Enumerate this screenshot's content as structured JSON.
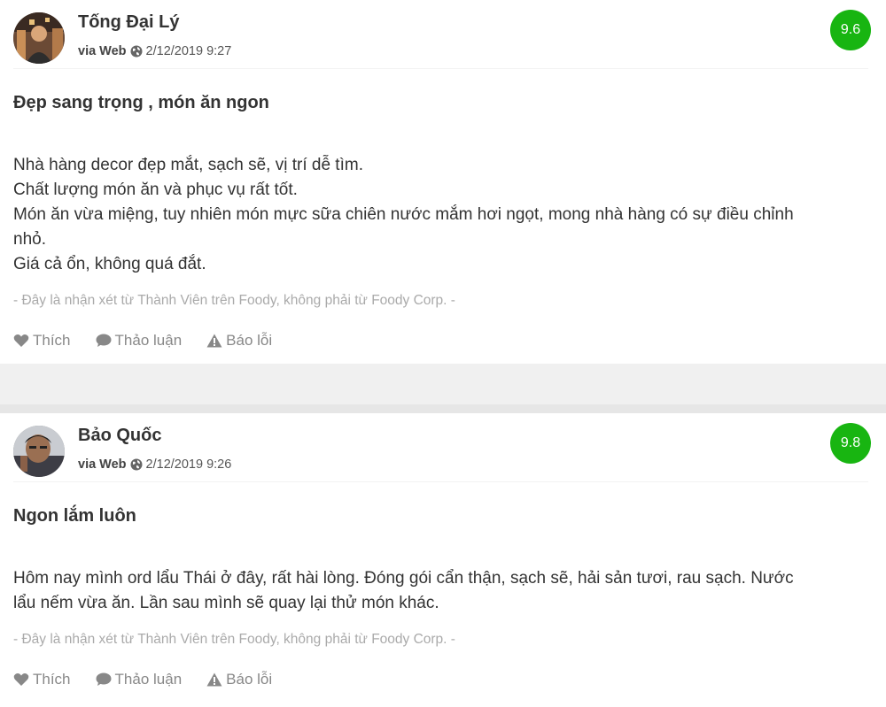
{
  "reviews": [
    {
      "user_name": "Tống Đại Lý",
      "via_label": "via Web",
      "timestamp": "2/12/2019 9:27",
      "score": "9.6",
      "title": "Đẹp sang trọng , món ăn ngon",
      "body_lines": [
        "Nhà hàng decor đẹp mắt, sạch sẽ, vị trí dễ tìm.",
        "Chất lượng món ăn và phục vụ rất tốt.",
        "Món ăn vừa miệng, tuy nhiên món mực sữa chiên nước mắm hơi ngọt, mong nhà hàng có sự điều chỉnh",
        "nhỏ.",
        "Giá cả ổn, không quá đắt."
      ],
      "disclaimer": "- Đây là nhận xét từ Thành Viên trên Foody, không phải từ Foody Corp. -",
      "actions": {
        "like": "Thích",
        "discuss": "Thảo luận",
        "report": "Báo lỗi"
      }
    },
    {
      "user_name": "Bảo Quốc",
      "via_label": "via Web",
      "timestamp": "2/12/2019 9:26",
      "score": "9.8",
      "title": "Ngon lắm luôn",
      "body_lines": [
        "Hôm nay mình ord lẩu Thái ở đây, rất hài lòng. Đóng gói cẩn thận, sạch sẽ, hải sản tươi, rau sạch. Nước",
        "lẩu nếm vừa ăn. Lần sau mình sẽ quay lại thử món khác."
      ],
      "disclaimer": "- Đây là nhận xét từ Thành Viên trên Foody, không phải từ Foody Corp. -",
      "actions": {
        "like": "Thích",
        "discuss": "Thảo luận",
        "report": "Báo lỗi"
      }
    }
  ],
  "colors": {
    "score_badge": "#18b511",
    "action_text": "#888888",
    "disclaimer_text": "#aaaaaa"
  },
  "icons": {
    "via": "globe-icon",
    "like": "heart-icon",
    "discuss": "comment-icon",
    "report": "warning-icon"
  }
}
